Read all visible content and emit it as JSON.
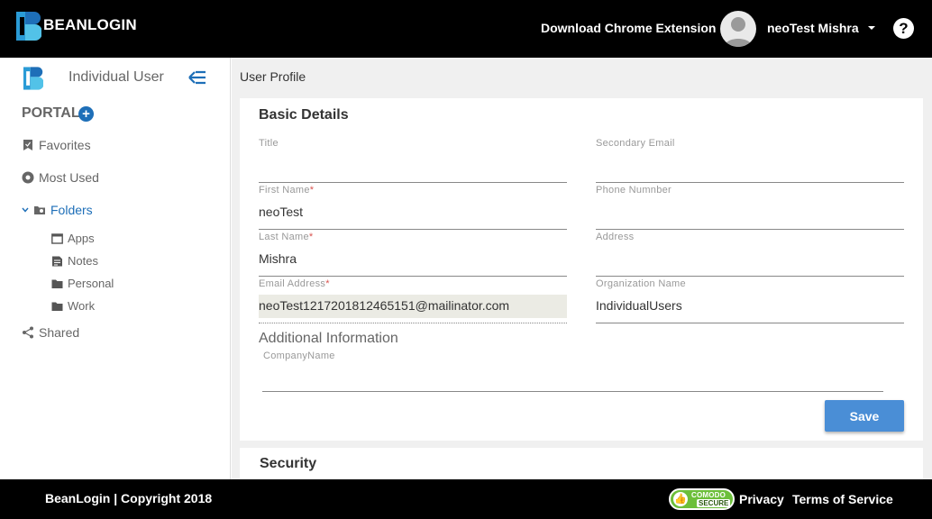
{
  "header": {
    "brand": "BEANLOGIN",
    "download_extension": "Download Chrome Extension",
    "username": "neoTest Mishra",
    "help": "?"
  },
  "sidebar": {
    "user_type": "Individual User",
    "portal_label": "PORTAL",
    "items": [
      {
        "label": "Favorites",
        "icon": "bookmark-icon"
      },
      {
        "label": "Most Used",
        "icon": "most-used-icon"
      },
      {
        "label": "Folders",
        "icon": "folder-icon"
      },
      {
        "label": "Shared",
        "icon": "share-icon"
      }
    ],
    "folders": [
      {
        "label": "Apps",
        "icon": "window-icon"
      },
      {
        "label": "Notes",
        "icon": "note-icon"
      },
      {
        "label": "Personal",
        "icon": "folder-icon"
      },
      {
        "label": "Work",
        "icon": "folder-icon"
      }
    ]
  },
  "main": {
    "breadcrumb": "User Profile",
    "basic_details": {
      "title": "Basic Details",
      "fields": {
        "title": {
          "label": "Title",
          "value": ""
        },
        "secondary_email": {
          "label": "Secondary Email",
          "value": ""
        },
        "first_name": {
          "label": "First Name",
          "value": "neoTest",
          "required": "*"
        },
        "phone": {
          "label": "Phone Numnber",
          "value": ""
        },
        "last_name": {
          "label": "Last Name",
          "value": "Mishra",
          "required": "*"
        },
        "address": {
          "label": "Address",
          "value": ""
        },
        "email": {
          "label": "Email Address",
          "value": "neoTest1217201812465151@mailinator.com",
          "required": "*"
        },
        "organization": {
          "label": "Organization Name",
          "value": "IndividualUsers"
        }
      },
      "additional_info": "Additional Information",
      "company_label": "CompanyName",
      "save_label": "Save"
    },
    "security_title": "Security"
  },
  "footer": {
    "copyright": "BeanLogin | Copyright 2018",
    "comodo_top": "COMODO",
    "comodo_bottom": "SECURE",
    "privacy": "Privacy",
    "terms": "Terms of Service"
  },
  "colors": {
    "accent": "#1e6fb8",
    "button": "#4a8ed6",
    "header_bg": "#000000",
    "required": "#d9534f",
    "comodo_green": "#6cbf3a"
  }
}
